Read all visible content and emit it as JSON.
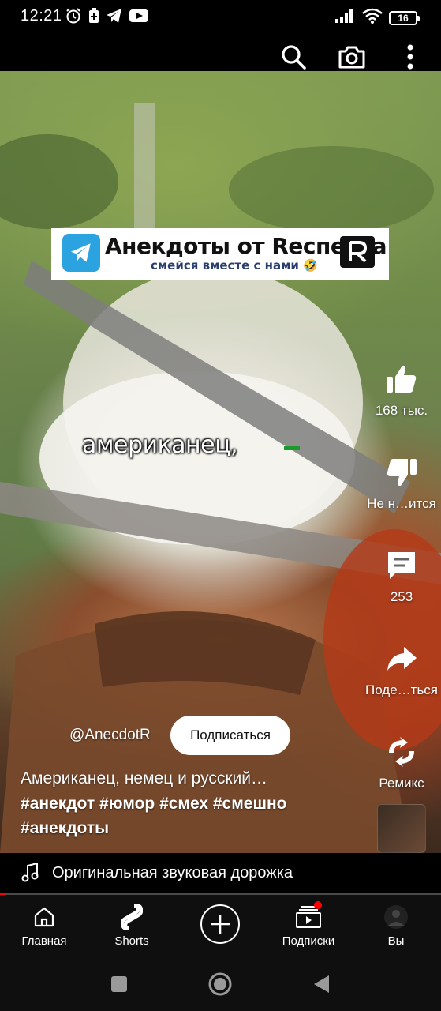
{
  "status_bar": {
    "time": "12:21",
    "battery": "16",
    "icons": [
      "alarm-icon",
      "battery-saver-icon",
      "telegram-icon",
      "youtube-icon",
      "signal-icon",
      "wifi-icon",
      "battery-icon"
    ]
  },
  "top_bar": {
    "icons": [
      "search-icon",
      "camera-icon",
      "more-vert-icon"
    ]
  },
  "video": {
    "watermark_title": "Анекдоты от Recпекта",
    "watermark_subtitle": "смейся вместе с нами 🤣",
    "caption": "американец,"
  },
  "actions": {
    "like": "168 тыс.",
    "dislike": "Не н…ится",
    "comments": "253",
    "share": "Поде…ться",
    "remix": "Ремикс"
  },
  "channel": {
    "handle": "@AnecdotR",
    "subscribe_label": "Подписаться"
  },
  "video_title": "Американец, немец и русский…",
  "hashtags": "#анекдот #юмор #смех #смешно #анекдоты",
  "audio": {
    "label": "Оригинальная звуковая дорожка"
  },
  "progress": 0.01,
  "colors": {
    "accent": "#ff0000",
    "nav_bg": "#0f0f0f",
    "telegram": "#2aa3e0"
  },
  "bottom_nav": {
    "home": "Главная",
    "shorts": "Shorts",
    "subscriptions": "Подписки",
    "you": "Вы"
  }
}
